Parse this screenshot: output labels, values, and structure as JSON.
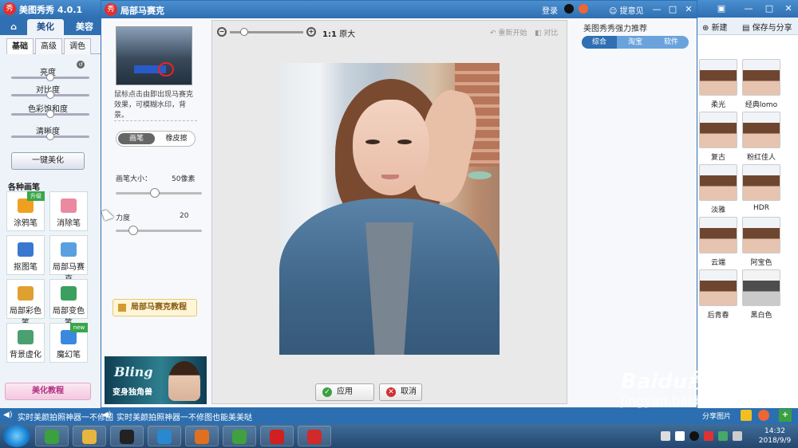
{
  "bg_app": {
    "title": "美图秀秀 4.0.1",
    "logo": "秀",
    "tabs": [
      "美化",
      "美容"
    ],
    "sub_tabs": [
      "基础",
      "高级",
      "调色"
    ],
    "sliders": [
      {
        "label": "亮度",
        "value": 0.5
      },
      {
        "label": "对比度",
        "value": 0.5
      },
      {
        "label": "色彩饱和度",
        "value": 0.5
      },
      {
        "label": "清晰度",
        "value": 0.5
      }
    ],
    "one_key": "一键美化",
    "brush_title": "各种画笔",
    "tools": [
      {
        "label": "涂鸦笔",
        "tag": "升级",
        "color": "#f0a020"
      },
      {
        "label": "消除笔",
        "tag": "",
        "color": "#e98aa0"
      },
      {
        "label": "抠图笔",
        "tag": "",
        "color": "#3a78d0"
      },
      {
        "label": "局部马赛克",
        "tag": "",
        "color": "#5aa0e0"
      },
      {
        "label": "局部彩色笔",
        "tag": "",
        "color": "#e0a030"
      },
      {
        "label": "局部变色笔",
        "tag": "",
        "color": "#3aa060"
      },
      {
        "label": "背景虚化",
        "tag": "",
        "color": "#4aa070"
      },
      {
        "label": "魔幻笔",
        "tag": "new",
        "color": "#3a88e0"
      }
    ],
    "tutorial": "美化教程",
    "marquee": "实时美颜拍照神器一不修图"
  },
  "dialog": {
    "title": "局部马赛克",
    "logo": "秀",
    "login": "登录",
    "feedback": "提意见",
    "hint": "鼠标点击由即出现马赛克效果，可模糊水印，背景。",
    "pen_modes": [
      "画笔",
      "橡皮擦"
    ],
    "pen_size_label": "画笔大小：",
    "pen_size_value": "50像素",
    "pen_size_level": 0.45,
    "strength_label": "力度",
    "strength_value": "20",
    "strength_level": 0.2,
    "mosaic_tutorial": "局部马赛克教程",
    "banner_text1": "Bling",
    "banner_text2": "变身独角兽",
    "zoom_level": 0.2,
    "zoom_label_bold": "1:1",
    "zoom_label": "原大",
    "restart": "重新开始",
    "compare": "对比",
    "apply": "应用",
    "cancel": "取消",
    "recommend_title": "美图秀秀强力推荐",
    "recommend_tabs": [
      "综合",
      "淘宝",
      "软件"
    ],
    "marquee": "实时美颜拍照神器一不修图也能美美哒"
  },
  "right_app": {
    "new_label": "新建",
    "save_label": "保存与分享",
    "filters": [
      "柔光",
      "经典lomo",
      "复古",
      "粉红佳人",
      "淡雅",
      "HDR",
      "云端",
      "阿宝色",
      "后青春",
      "黑白色"
    ],
    "share": "分享图片"
  },
  "taskbar": {
    "time": "14:32",
    "date": "2018/9/9",
    "apps": [
      {
        "name": "ie",
        "color": "#3aa040"
      },
      {
        "name": "explorer",
        "color": "#e8b540"
      },
      {
        "name": "qq",
        "color": "#222"
      },
      {
        "name": "media",
        "color": "#2a88d0"
      },
      {
        "name": "firefox",
        "color": "#e07020"
      },
      {
        "name": "app",
        "color": "#40a040"
      },
      {
        "name": "recorder",
        "color": "#d02020"
      },
      {
        "name": "meitu",
        "color": "#d02a2a"
      }
    ]
  },
  "watermark": {
    "brand": "Baidu经验",
    "url": "jingyan.baidu.com"
  }
}
